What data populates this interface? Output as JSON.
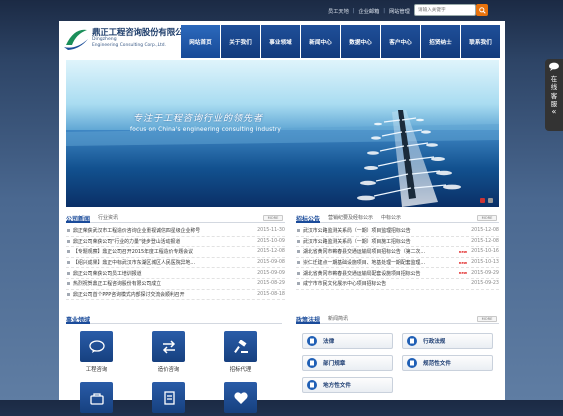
{
  "topbar": {
    "links": [
      "员工天地",
      "企业邮箱",
      "网站管理"
    ]
  },
  "search": {
    "placeholder": "请输入关键字"
  },
  "logo": {
    "cn": "鼎正工程咨询股份有限公司",
    "en1": "Dingzheng",
    "en2": "Engineering Consulting Corp.,Ltd."
  },
  "nav": {
    "items": [
      "网站首页",
      "关于我们",
      "事业领域",
      "新闻中心",
      "数据中心",
      "客户中心",
      "招贤纳士",
      "联系我们"
    ]
  },
  "banner": {
    "slogan": "专注于工程咨询行业的领先者",
    "slogan_en": "focus on China's engineering consulting industry"
  },
  "company_news": {
    "title": "公司新闻",
    "tab": "行业资讯",
    "more": "MORE",
    "items": [
      {
        "text": "鼎正荣获武汉市工程造价咨询企业重视诚信四星级企业称号",
        "date": "2015-11-30",
        "new": false
      },
      {
        "text": "鼎正公司荣获公司\"行业的力量\"徒步登山活动报道",
        "date": "2015-10-09",
        "new": false
      },
      {
        "text": "【专题观察】鼎正公司召开2015年度工程造价专题会议",
        "date": "2015-12-08",
        "new": false
      },
      {
        "text": "【绍兴成果】鼎正中标武汉市东湖区城区人民医院异地...",
        "date": "2015-09-08",
        "new": false
      },
      {
        "text": "鼎正公司荣获公司员工培训报道",
        "date": "2015-09-09",
        "new": false
      },
      {
        "text": "热烈祝贺鼎正工程咨询股份有限公司成立",
        "date": "2015-08-29",
        "new": false
      },
      {
        "text": "鼎正公司首个PPP咨询模式内部探讨交流会顺利召开",
        "date": "2015-08-18",
        "new": false
      }
    ]
  },
  "tender": {
    "title": "招标公告",
    "tabs": [
      "营销纪要及经标公示",
      "中标公示"
    ],
    "more": "MORE",
    "items": [
      {
        "text": "武汉市公路监测关系局（一期）项目监理招标公告",
        "date": "2015-12-08",
        "new": false
      },
      {
        "text": "武汉市公路监测关系局（一期）项目施工招标公告",
        "date": "2015-12-08",
        "new": false
      },
      {
        "text": "湖北省黄冈市蕲春县交通运输局项目招标公告（第二次...",
        "date": "2015-10-16",
        "new": true
      },
      {
        "text": "崇仁迁建点一期基础设施项目、地基处理一期配套监理...",
        "date": "2015-10-13",
        "new": true
      },
      {
        "text": "湖北省黄冈市蕲春县交通运输局配套设施项目招标公告",
        "date": "2015-09-29",
        "new": true
      },
      {
        "text": "咸宁市市民文化展示中心项目招标公告",
        "date": "2015-09-23",
        "new": false
      }
    ]
  },
  "business": {
    "title": "事业领域",
    "items": [
      {
        "label": "工程咨询",
        "icon": "chat-bubble-icon"
      },
      {
        "label": "造价咨询",
        "icon": "exchange-arrows-icon"
      },
      {
        "label": "招标代理",
        "icon": "gavel-icon"
      },
      {
        "label": "",
        "icon": "bag-icon"
      },
      {
        "label": "",
        "icon": "document-icon"
      },
      {
        "label": "",
        "icon": "heart-icon"
      }
    ]
  },
  "policy": {
    "title": "政策法规",
    "tab": "新闻简讯",
    "more": "MORE",
    "items": [
      "法律",
      "行政法规",
      "部门规章",
      "规范性文件",
      "地方性文件"
    ]
  },
  "side": {
    "label": "在线客服",
    "arrow": "«"
  },
  "colors": {
    "nav_blue": "#1a4b9a",
    "accent_orange": "#e8720c",
    "new_red": "#e02020"
  }
}
